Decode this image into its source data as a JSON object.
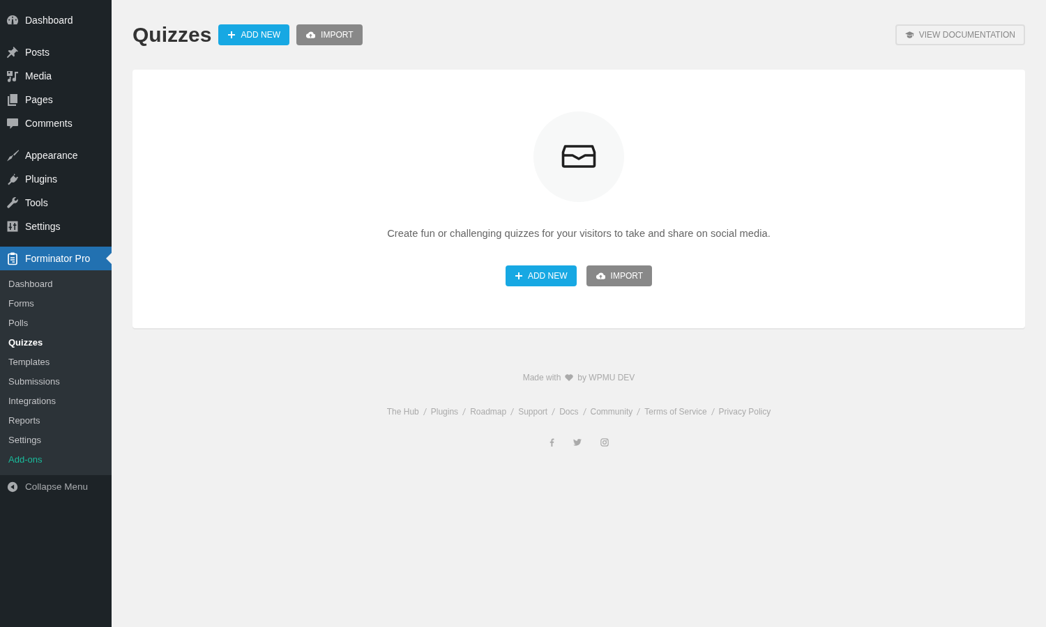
{
  "sidebar": {
    "groups": [
      [
        {
          "label": "Dashboard",
          "selected": false
        }
      ],
      [
        {
          "label": "Posts",
          "selected": false
        },
        {
          "label": "Media",
          "selected": false
        },
        {
          "label": "Pages",
          "selected": false
        },
        {
          "label": "Comments",
          "selected": false
        }
      ],
      [
        {
          "label": "Appearance",
          "selected": false
        },
        {
          "label": "Plugins",
          "selected": false
        },
        {
          "label": "Tools",
          "selected": false
        },
        {
          "label": "Settings",
          "selected": false
        }
      ],
      [
        {
          "label": "Forminator Pro",
          "selected": true,
          "submenu": [
            {
              "label": "Dashboard",
              "selected": false
            },
            {
              "label": "Forms",
              "selected": false
            },
            {
              "label": "Polls",
              "selected": false
            },
            {
              "label": "Quizzes",
              "selected": true
            },
            {
              "label": "Templates",
              "selected": false
            },
            {
              "label": "Submissions",
              "selected": false
            },
            {
              "label": "Integrations",
              "selected": false
            },
            {
              "label": "Reports",
              "selected": false
            },
            {
              "label": "Settings",
              "selected": false
            },
            {
              "label": "Add-ons",
              "selected": false,
              "color": "#1abc9c"
            }
          ]
        }
      ]
    ],
    "collapse_label": "Collapse Menu"
  },
  "header": {
    "title": "Quizzes",
    "buttons": [
      {
        "label": "ADD NEW",
        "kind": "primary"
      },
      {
        "label": "IMPORT",
        "kind": "secondary"
      }
    ],
    "docs_button": "VIEW DOCUMENTATION"
  },
  "empty_state": {
    "message": "Create fun or challenging quizzes for your visitors to take and share on social media.",
    "buttons": [
      {
        "label": "ADD NEW",
        "kind": "primary"
      },
      {
        "label": "IMPORT",
        "kind": "secondary"
      }
    ]
  },
  "footer": {
    "made_with": "Made with",
    "by_line": "by WPMU DEV",
    "links": [
      "The Hub",
      "Plugins",
      "Roadmap",
      "Support",
      "Docs",
      "Community",
      "Terms of Service",
      "Privacy Policy"
    ]
  }
}
